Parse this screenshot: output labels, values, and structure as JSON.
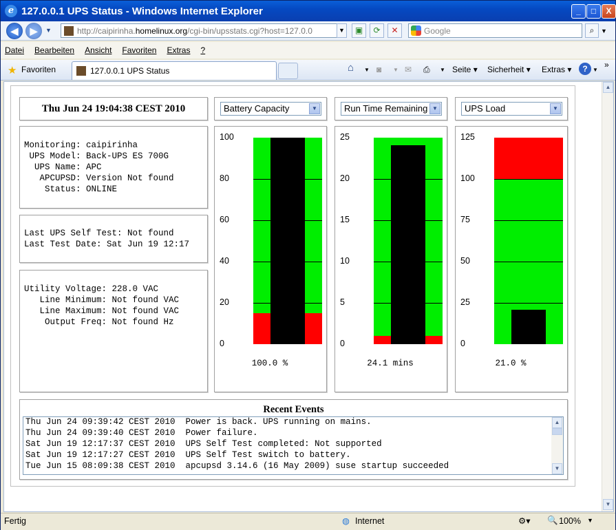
{
  "window": {
    "title": "127.0.0.1 UPS Status - Windows Internet Explorer",
    "logo": "ie-logo-icon",
    "controls": {
      "minimize": "_",
      "maximize": "□",
      "close": "X"
    }
  },
  "address_bar": {
    "url_prefix": "http://caipirinha.",
    "url_domain": "homelinux.org",
    "url_suffix": "/cgi-bin/upsstats.cgi?host=127.0.0",
    "search_placeholder": "Google"
  },
  "menu": [
    "Datei",
    "Bearbeiten",
    "Ansicht",
    "Favoriten",
    "Extras",
    "?"
  ],
  "favorites_bar": {
    "favorites_label": "Favoriten",
    "tab_title": "127.0.0.1 UPS Status",
    "commands": {
      "page": "Seite",
      "security": "Sicherheit",
      "tools": "Extras"
    }
  },
  "ups": {
    "date": "Thu Jun 24 19:04:38 CEST 2010",
    "info": "Monitoring: caipirinha\n UPS Model: Back-UPS ES 700G\n  UPS Name: APC\n   APCUPSD: Version Not found\n    Status: ONLINE",
    "selftest": "Last UPS Self Test: Not found\nLast Test Date: Sat Jun 19 12:17",
    "voltage": "Utility Voltage: 228.0 VAC\n   Line Minimum: Not found VAC\n   Line Maximum: Not found VAC\n    Output Freq: Not found Hz"
  },
  "gauges": [
    {
      "select": "Battery Capacity",
      "ticks": [
        "100",
        "80",
        "60",
        "40",
        "20",
        "0"
      ],
      "max": 100,
      "value": 100.0,
      "red_low": 15,
      "red_high": null,
      "readout": "100.0 %"
    },
    {
      "select": "Run Time Remaining",
      "ticks": [
        "25",
        "20",
        "15",
        "10",
        "5",
        "0"
      ],
      "max": 25,
      "value": 24.1,
      "red_low": 1,
      "red_high": null,
      "readout": "24.1 mins"
    },
    {
      "select": "UPS Load",
      "ticks": [
        "125",
        "100",
        "75",
        "50",
        "25",
        "0"
      ],
      "max": 125,
      "value": 21.0,
      "red_low": null,
      "red_high": 100,
      "readout": "21.0 %"
    }
  ],
  "colors": {
    "ok": "#00ee00",
    "warn": "#ff0000",
    "bar": "#000000"
  },
  "events": {
    "title": "Recent Events",
    "rows": [
      "Thu Jun 24 09:39:42 CEST 2010  Power is back. UPS running on mains.",
      "Thu Jun 24 09:39:40 CEST 2010  Power failure.",
      "Sat Jun 19 12:17:37 CEST 2010  UPS Self Test completed: Not supported",
      "Sat Jun 19 12:17:27 CEST 2010  UPS Self Test switch to battery.",
      "Tue Jun 15 08:09:38 CEST 2010  apcupsd 3.14.6 (16 May 2009) suse startup succeeded"
    ]
  },
  "status_bar": {
    "left": "Fertig",
    "zone": "Internet",
    "zoom": "100%"
  }
}
